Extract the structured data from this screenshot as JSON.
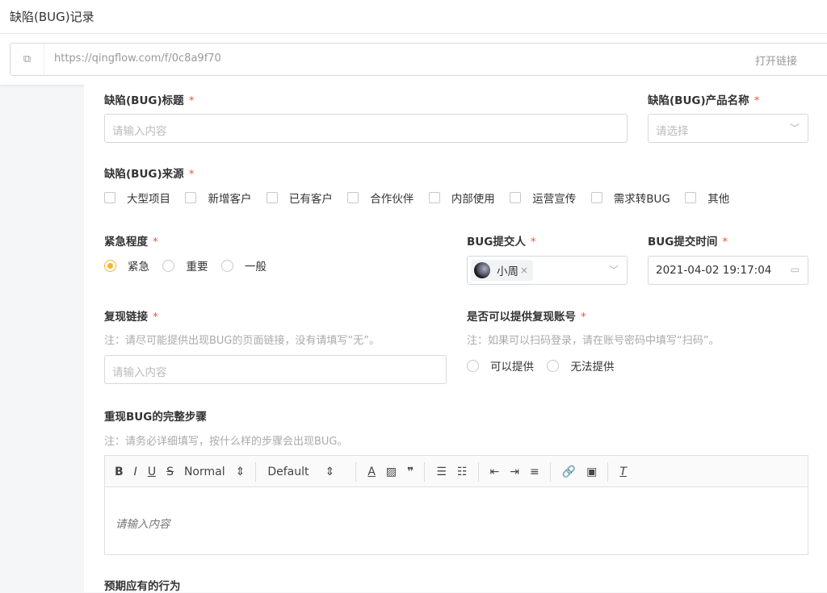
{
  "title": "缺陷(BUG)记录",
  "link": {
    "url": "https://qingflow.com/f/0c8a9f70",
    "open_label": "打开链接"
  },
  "fields": {
    "bug_title": {
      "label": "缺陷(BUG)标题",
      "required": "*",
      "placeholder": "请输入内容"
    },
    "product": {
      "label": "缺陷(BUG)产品名称",
      "required": "*",
      "placeholder": "请选择"
    },
    "source": {
      "label": "缺陷(BUG)来源",
      "required": "*",
      "options": [
        "大型项目",
        "新增客户",
        "已有客户",
        "合作伙伴",
        "内部使用",
        "运营宣传",
        "需求转BUG",
        "其他"
      ]
    },
    "urgency": {
      "label": "紧急程度",
      "required": "*",
      "options": [
        "紧急",
        "重要",
        "一般"
      ],
      "selected": "紧急"
    },
    "submitter": {
      "label": "BUG提交人",
      "required": "*",
      "value": "小周"
    },
    "submit_time": {
      "label": "BUG提交时间",
      "required": "*",
      "value": "2021-04-02 19:17:04"
    },
    "repro_link": {
      "label": "复现链接",
      "required": "*",
      "hint": "注：请尽可能提供出现BUG的页面链接，没有请填写“无”。",
      "placeholder": "请输入内容"
    },
    "account": {
      "label": "是否可以提供复现账号",
      "required": "*",
      "hint": "注：如果可以扫码登录，请在账号密码中填写“扫码”。",
      "options": [
        "可以提供",
        "无法提供"
      ]
    },
    "steps": {
      "label": "重现BUG的完整步骤",
      "hint": "注：请务必详细填写，按什么样的步骤会出现BUG。",
      "placeholder": "请输入内容",
      "toolbar": {
        "header": "Normal",
        "font": "Default"
      }
    },
    "expected": {
      "label": "预期应有的行为"
    }
  },
  "colors": {
    "accent": "#f5b52b",
    "required": "#f0553c"
  }
}
